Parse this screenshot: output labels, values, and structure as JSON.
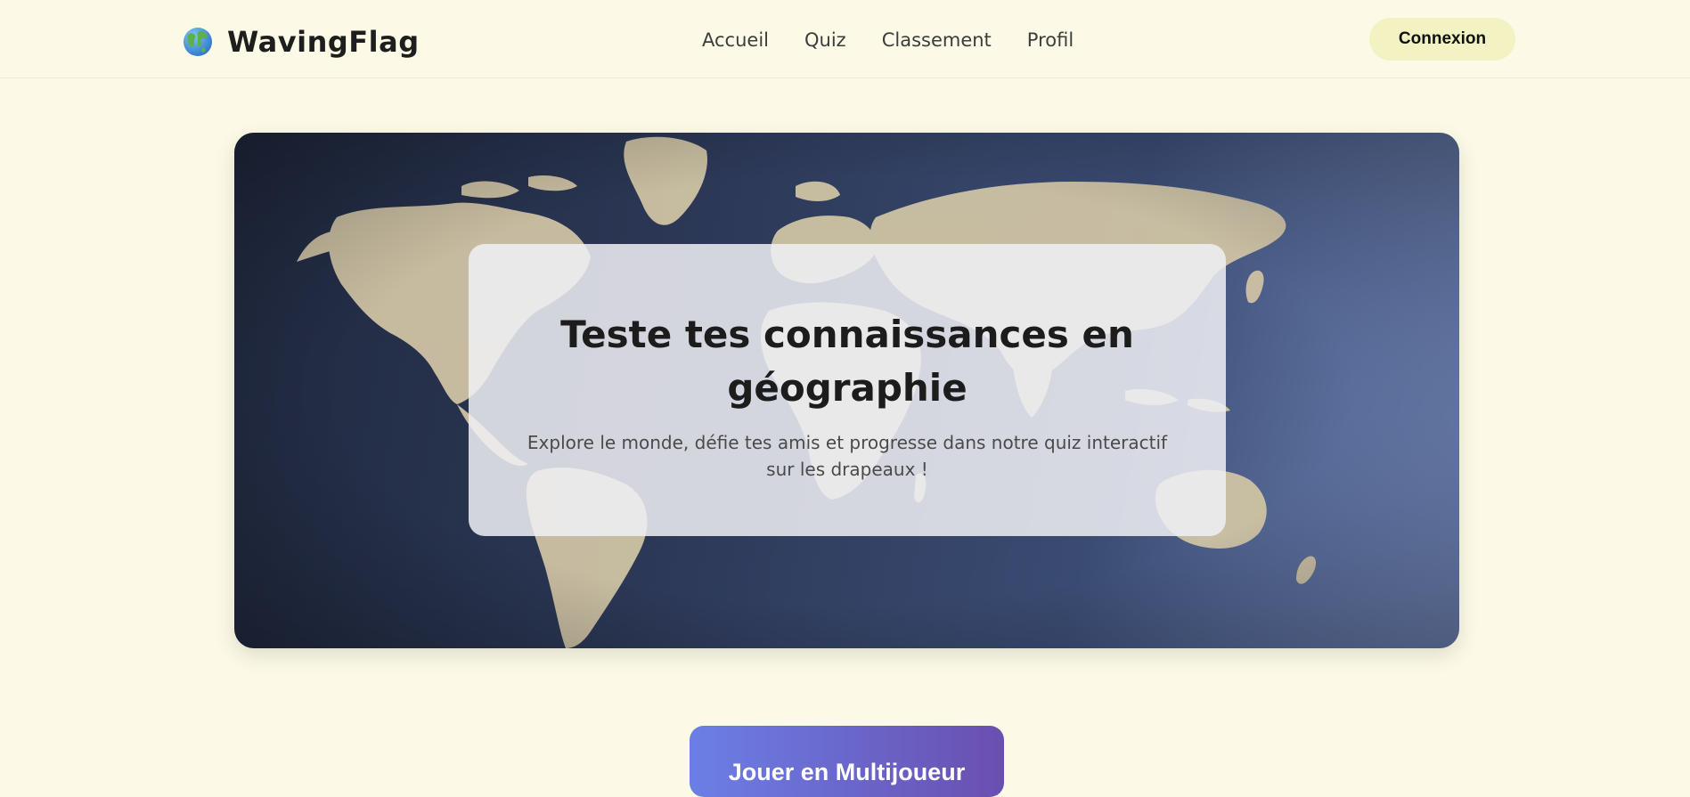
{
  "header": {
    "logo_text": "WavingFlag",
    "logo_icon": "globe-icon",
    "nav": [
      {
        "label": "Accueil"
      },
      {
        "label": "Quiz"
      },
      {
        "label": "Classement"
      },
      {
        "label": "Profil"
      }
    ],
    "login_label": "Connexion"
  },
  "hero": {
    "background": "world-map-texture",
    "title": "Teste tes connaissances en géographie",
    "subtitle": "Explore le monde, défie tes amis et progresse dans notre quiz interactif sur les drapeaux !"
  },
  "actions": {
    "multiplayer_label": "Jouer en Multijoueur"
  },
  "colors": {
    "page_bg": "#fcfae6",
    "login_bg": "#f2f2c2",
    "button_gradient_start": "#6b7fe6",
    "button_gradient_end": "#6a4fb0"
  }
}
